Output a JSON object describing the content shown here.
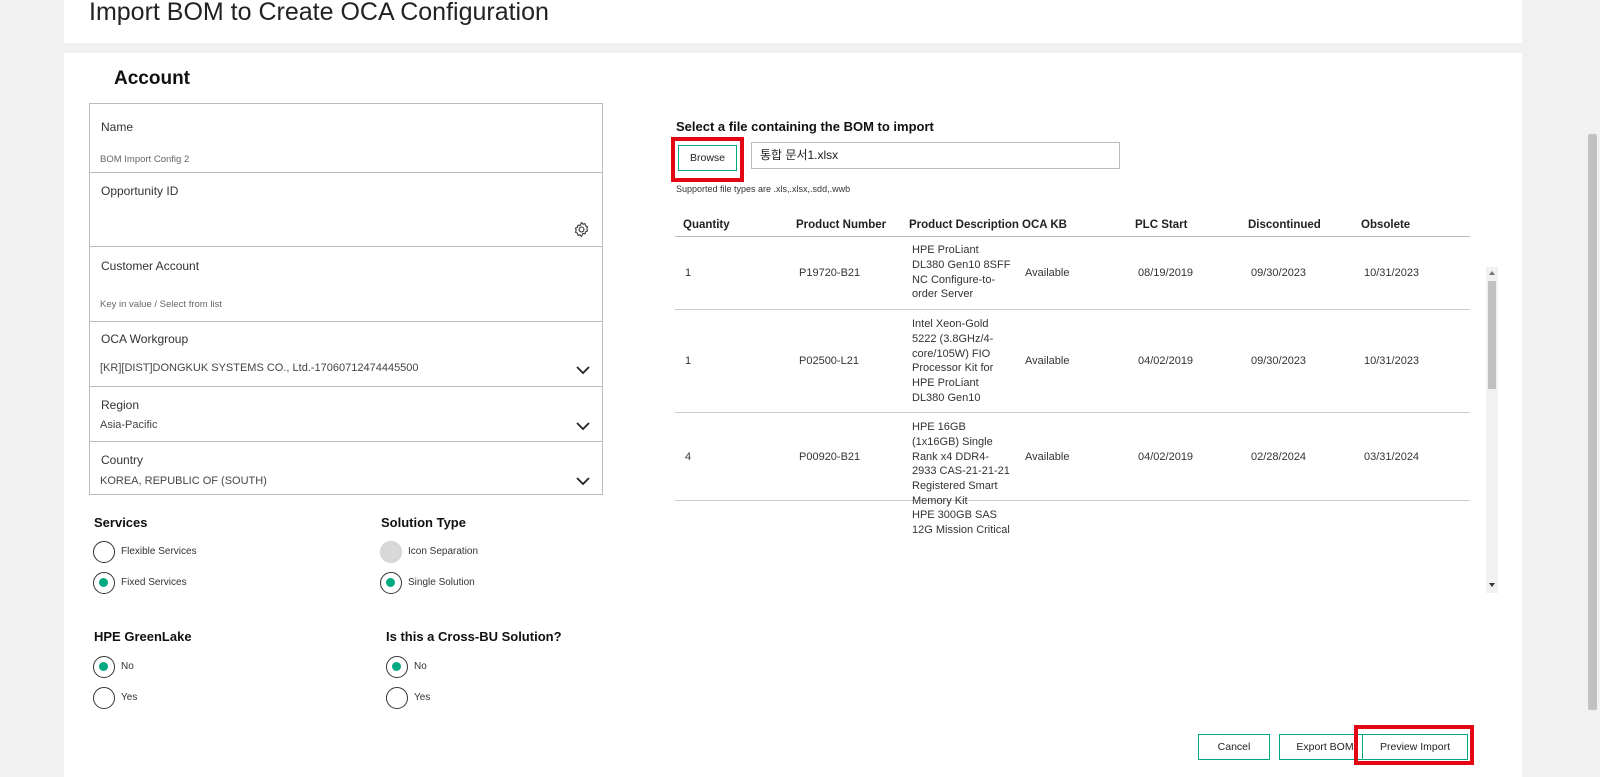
{
  "page_title": "Import BOM to Create OCA Configuration",
  "account": {
    "heading": "Account",
    "name": {
      "label": "Name",
      "value": "BOM Import Config 2"
    },
    "opportunity": {
      "label": "Opportunity ID",
      "value": ""
    },
    "customer": {
      "label": "Customer Account",
      "placeholder": "Key in value / Select from list"
    },
    "workgroup": {
      "label": "OCA Workgroup",
      "value": "[KR][DIST]DONGKUK SYSTEMS CO., Ltd.-17060712474445500"
    },
    "region": {
      "label": "Region",
      "value": "Asia-Pacific"
    },
    "country": {
      "label": "Country",
      "value": "KOREA, REPUBLIC OF (SOUTH)"
    }
  },
  "services": {
    "label": "Services",
    "options": [
      "Flexible Services",
      "Fixed Services"
    ],
    "selected": "Fixed Services"
  },
  "solution_type": {
    "label": "Solution Type",
    "options": [
      "Icon Separation",
      "Single Solution"
    ],
    "selected": "Single Solution",
    "disabled": [
      "Icon Separation"
    ]
  },
  "greenlake": {
    "label": "HPE GreenLake",
    "options": [
      "No",
      "Yes"
    ],
    "selected": "No"
  },
  "cross_bu": {
    "label": "Is this a Cross-BU Solution?",
    "options": [
      "No",
      "Yes"
    ],
    "selected": "No"
  },
  "file": {
    "label": "Select a file containing the BOM to import",
    "browse_label": "Browse",
    "filename": "통합 문서1.xlsx",
    "hint": "Supported file types are .xls,.xlsx,.sdd,.wwb"
  },
  "table": {
    "headers": [
      "Quantity",
      "Product Number",
      "Product Description",
      "OCA KB",
      "PLC Start",
      "Discontinued",
      "Obsolete"
    ],
    "rows": [
      {
        "qty": "1",
        "pn": "P19720-B21",
        "desc": "HPE ProLiant DL380 Gen10 8SFF NC Configure-to-order Server",
        "kb": "Available",
        "plc": "08/19/2019",
        "disc": "09/30/2023",
        "obs": "10/31/2023"
      },
      {
        "qty": "1",
        "pn": "P02500-L21",
        "desc": "Intel Xeon-Gold 5222 (3.8GHz/4-core/105W) FIO Processor Kit for HPE ProLiant DL380 Gen10",
        "kb": "Available",
        "plc": "04/02/2019",
        "disc": "09/30/2023",
        "obs": "10/31/2023"
      },
      {
        "qty": "4",
        "pn": "P00920-B21",
        "desc": "HPE 16GB (1x16GB) Single Rank x4 DDR4-2933 CAS-21-21-21 Registered Smart Memory Kit",
        "kb": "Available",
        "plc": "04/02/2019",
        "disc": "02/28/2024",
        "obs": "03/31/2024"
      },
      {
        "qty": "",
        "pn": "",
        "desc": "HPE 300GB SAS 12G Mission Critical",
        "kb": "",
        "plc": "",
        "disc": "",
        "obs": ""
      }
    ]
  },
  "actions": {
    "cancel": "Cancel",
    "export": "Export BOM",
    "preview": "Preview Import"
  },
  "colors": {
    "accent": "#01a982",
    "highlight": "#e30613"
  }
}
